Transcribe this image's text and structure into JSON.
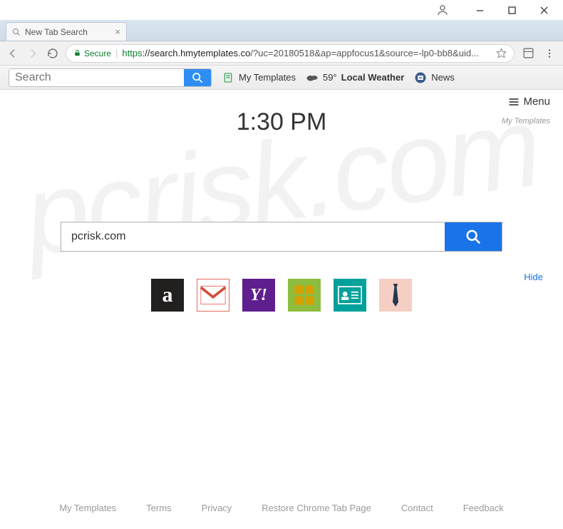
{
  "window": {
    "tab_title": "New Tab Search"
  },
  "address": {
    "secure_label": "Secure",
    "scheme": "https",
    "host": "://search.hmytemplates.co",
    "path": "/?uc=20180518&ap=appfocus1&source=-lp0-bb8&uid..."
  },
  "toolbar": {
    "search_placeholder": "Search",
    "templates_label": "My Templates",
    "weather_temp": "59°",
    "weather_label": "Local Weather",
    "news_label": "News"
  },
  "page": {
    "menu_label": "Menu",
    "brand_mini": "My Templates",
    "clock": "1:30 PM",
    "main_search_value": "pcrisk.com",
    "hide_label": "Hide"
  },
  "tiles": {
    "amazon": "a",
    "gmail": "M",
    "yahoo": "Y!",
    "resume": "",
    "card": "",
    "tie": ""
  },
  "footer": {
    "templates": "My Templates",
    "terms": "Terms",
    "privacy": "Privacy",
    "restore": "Restore Chrome Tab Page",
    "contact": "Contact",
    "feedback": "Feedback"
  },
  "watermark": "pcrisk.com"
}
